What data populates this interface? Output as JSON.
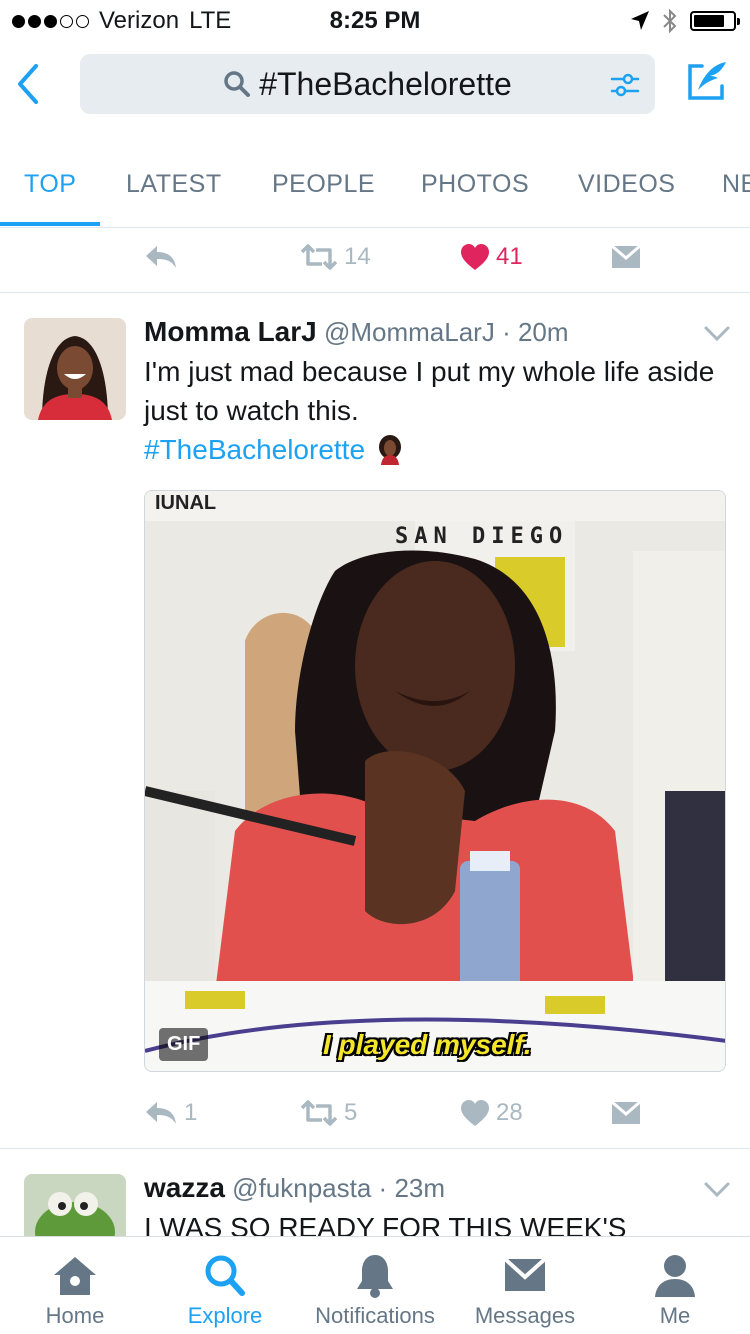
{
  "status_bar": {
    "carrier": "Verizon",
    "network": "LTE",
    "time": "8:25 PM",
    "signal_bars_filled": 3,
    "signal_bars_total": 5,
    "battery_level": 0.8
  },
  "header": {
    "search_query": "#TheBachelorette",
    "back_icon": "chevron-left-icon",
    "filter_icon": "sliders-icon",
    "compose_icon": "compose-feather-icon"
  },
  "tabs": [
    {
      "label": "TOP",
      "active": true
    },
    {
      "label": "LATEST",
      "active": false
    },
    {
      "label": "PEOPLE",
      "active": false
    },
    {
      "label": "PHOTOS",
      "active": false
    },
    {
      "label": "VIDEOS",
      "active": false
    },
    {
      "label": "NE",
      "active": false
    }
  ],
  "prev_tweet_actions": {
    "retweets": "14",
    "likes": "41"
  },
  "tweets": [
    {
      "name": "Momma LarJ",
      "handle": "@MommaLarJ",
      "separator": "·",
      "time": "20m",
      "text": "I'm just mad because I put my whole life aside just to watch this.",
      "hashtag": "#TheBachelorette",
      "media": {
        "badge": "GIF",
        "caption": "I played myself."
      },
      "actions": {
        "replies": "1",
        "retweets": "5",
        "likes": "28"
      }
    },
    {
      "name": "wazza",
      "handle": "@fuknpasta",
      "separator": "·",
      "time": "23m",
      "text": "I WAS SO READY FOR THIS WEEK'S"
    }
  ],
  "tabbar": [
    {
      "label": "Home",
      "icon": "home-icon",
      "active": false
    },
    {
      "label": "Explore",
      "icon": "search-icon",
      "active": true
    },
    {
      "label": "Notifications",
      "icon": "bell-icon",
      "active": false
    },
    {
      "label": "Messages",
      "icon": "envelope-icon",
      "active": false
    },
    {
      "label": "Me",
      "icon": "person-icon",
      "active": false
    }
  ],
  "colors": {
    "accent": "#1da1f2",
    "like": "#e0245e",
    "muted": "#657786",
    "icon_gray": "#aab8c2"
  }
}
